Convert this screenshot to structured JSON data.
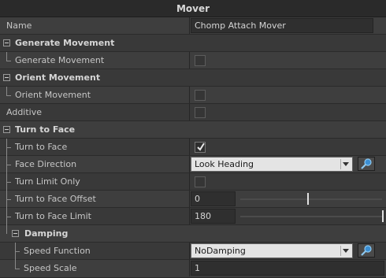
{
  "panel": {
    "title": "Mover"
  },
  "rows": {
    "name": {
      "label": "Name",
      "value": "Chomp Attach Mover"
    },
    "generate_movement_cat": {
      "label": "Generate Movement"
    },
    "generate_movement": {
      "label": "Generate Movement",
      "checked": false
    },
    "orient_movement_cat": {
      "label": "Orient Movement"
    },
    "orient_movement": {
      "label": "Orient Movement",
      "checked": false
    },
    "additive": {
      "label": "Additive",
      "checked": false
    },
    "turn_to_face_cat": {
      "label": "Turn to Face"
    },
    "turn_to_face": {
      "label": "Turn to Face",
      "checked": true
    },
    "face_direction": {
      "label": "Face Direction",
      "value": "Look Heading",
      "icon": "magnifier-icon"
    },
    "turn_limit_only": {
      "label": "Turn Limit Only",
      "checked": false
    },
    "turn_to_face_offset": {
      "label": "Turn to Face Offset",
      "value": "0"
    },
    "turn_to_face_limit": {
      "label": "Turn to Face Limit",
      "value": "180"
    },
    "damping_cat": {
      "label": "Damping"
    },
    "speed_function": {
      "label": "Speed Function",
      "value": "NoDamping",
      "icon": "magnifier-icon"
    },
    "speed_scale": {
      "label": "Speed Scale",
      "value": "1"
    }
  },
  "colors": {
    "accent": "#3b8fd4",
    "check": "#e8e8e8"
  }
}
